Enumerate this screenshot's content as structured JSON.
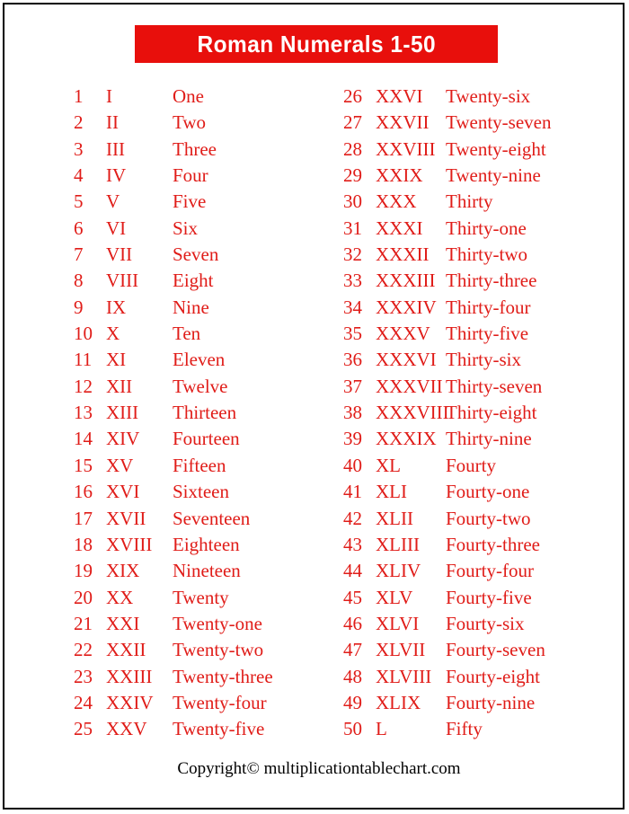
{
  "title": {
    "text": "Roman Numerals 1-50",
    "banner_color": "#e80f0c",
    "text_color": "#ffffff"
  },
  "theme": {
    "text_red": "#e01c18",
    "border_color": "#000000",
    "background": "#ffffff"
  },
  "table": {
    "columns": [
      {
        "name": "left-column",
        "rows": [
          {
            "number": "1",
            "roman": "I",
            "word": "One"
          },
          {
            "number": "2",
            "roman": "II",
            "word": "Two"
          },
          {
            "number": "3",
            "roman": "III",
            "word": "Three"
          },
          {
            "number": "4",
            "roman": "IV",
            "word": "Four"
          },
          {
            "number": "5",
            "roman": "V",
            "word": "Five"
          },
          {
            "number": "6",
            "roman": "VI",
            "word": "Six"
          },
          {
            "number": "7",
            "roman": "VII",
            "word": "Seven"
          },
          {
            "number": "8",
            "roman": "VIII",
            "word": "Eight"
          },
          {
            "number": "9",
            "roman": "IX",
            "word": "Nine"
          },
          {
            "number": "10",
            "roman": "X",
            "word": "Ten"
          },
          {
            "number": "11",
            "roman": "XI",
            "word": "Eleven"
          },
          {
            "number": "12",
            "roman": "XII",
            "word": "Twelve"
          },
          {
            "number": "13",
            "roman": "XIII",
            "word": "Thirteen"
          },
          {
            "number": "14",
            "roman": "XIV",
            "word": "Fourteen"
          },
          {
            "number": "15",
            "roman": "XV",
            "word": "Fifteen"
          },
          {
            "number": "16",
            "roman": "XVI",
            "word": "Sixteen"
          },
          {
            "number": "17",
            "roman": "XVII",
            "word": "Seventeen"
          },
          {
            "number": "18",
            "roman": "XVIII",
            "word": "Eighteen"
          },
          {
            "number": "19",
            "roman": "XIX",
            "word": "Nineteen"
          },
          {
            "number": "20",
            "roman": "XX",
            "word": "Twenty"
          },
          {
            "number": "21",
            "roman": "XXI",
            "word": "Twenty-one"
          },
          {
            "number": "22",
            "roman": "XXII",
            "word": "Twenty-two"
          },
          {
            "number": "23",
            "roman": "XXIII",
            "word": "Twenty-three"
          },
          {
            "number": "24",
            "roman": "XXIV",
            "word": "Twenty-four"
          },
          {
            "number": "25",
            "roman": "XXV",
            "word": "Twenty-five"
          }
        ]
      },
      {
        "name": "right-column",
        "rows": [
          {
            "number": "26",
            "roman": "XXVI",
            "word": "Twenty-six"
          },
          {
            "number": "27",
            "roman": "XXVII",
            "word": "Twenty-seven"
          },
          {
            "number": "28",
            "roman": "XXVIII",
            "word": "Twenty-eight"
          },
          {
            "number": "29",
            "roman": "XXIX",
            "word": "Twenty-nine"
          },
          {
            "number": "30",
            "roman": "XXX",
            "word": "Thirty"
          },
          {
            "number": "31",
            "roman": "XXXI",
            "word": "Thirty-one"
          },
          {
            "number": "32",
            "roman": "XXXII",
            "word": "Thirty-two"
          },
          {
            "number": "33",
            "roman": "XXXIII",
            "word": "Thirty-three"
          },
          {
            "number": "34",
            "roman": "XXXIV",
            "word": "Thirty-four"
          },
          {
            "number": "35",
            "roman": "XXXV",
            "word": "Thirty-five"
          },
          {
            "number": "36",
            "roman": "XXXVI",
            "word": "Thirty-six"
          },
          {
            "number": "37",
            "roman": "XXXVII",
            "word": "Thirty-seven"
          },
          {
            "number": "38",
            "roman": "XXXVIII",
            "word": "Thirty-eight"
          },
          {
            "number": "39",
            "roman": "XXXIX",
            "word": "Thirty-nine"
          },
          {
            "number": "40",
            "roman": "XL",
            "word": "Fourty"
          },
          {
            "number": "41",
            "roman": "XLI",
            "word": "Fourty-one"
          },
          {
            "number": "42",
            "roman": "XLII",
            "word": "Fourty-two"
          },
          {
            "number": "43",
            "roman": "XLIII",
            "word": "Fourty-three"
          },
          {
            "number": "44",
            "roman": "XLIV",
            "word": "Fourty-four"
          },
          {
            "number": "45",
            "roman": "XLV",
            "word": "Fourty-five"
          },
          {
            "number": "46",
            "roman": "XLVI",
            "word": "Fourty-six"
          },
          {
            "number": "47",
            "roman": "XLVII",
            "word": "Fourty-seven"
          },
          {
            "number": "48",
            "roman": "XLVIII",
            "word": "Fourty-eight"
          },
          {
            "number": "49",
            "roman": "XLIX",
            "word": "Fourty-nine"
          },
          {
            "number": "50",
            "roman": "L",
            "word": "Fifty"
          }
        ]
      }
    ]
  },
  "footer": {
    "text": "Copyright© multiplicationtablechart.com"
  }
}
